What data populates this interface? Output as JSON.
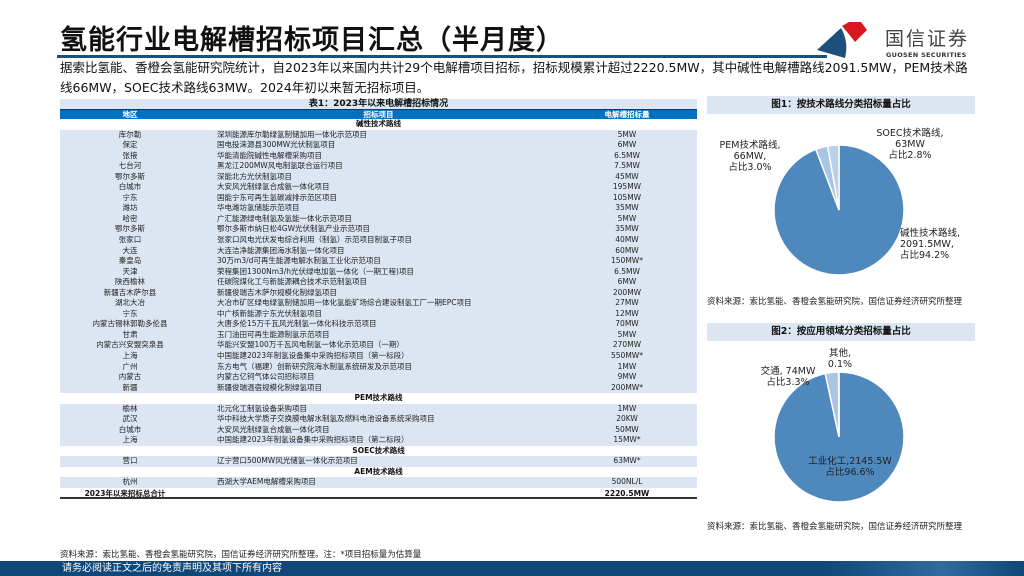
{
  "title": "氢能行业电解槽招标项目汇总（半月度）",
  "logo": {
    "cn": "国信证券",
    "en": "GUOSEN SECURITIES"
  },
  "intro": "据索比氢能、香橙会氢能研究院统计，自2023年以来国内共计29个电解槽项目招标，招标规模累计超过2220.5MW，其中碱性电解槽路线2091.5MW，PEM技术路线66MW，SOEC技术路线63MW。2024年初以来暂无招标项目。",
  "table": {
    "caption": "表1：2023年以来电解槽招标情况",
    "headers": [
      "地区",
      "招标项目",
      "电解槽招标量"
    ],
    "sections": [
      {
        "name": "碱性技术路线",
        "rows": [
          [
            "库尔勒",
            "深圳能源库尔勒绿氢制储加用一体化示范项目",
            "5MW"
          ],
          [
            "保定",
            "国电投涞源县300MW光伏制氢项目",
            "6MW"
          ],
          [
            "张掖",
            "华能清能院碱性电解槽采购项目",
            "6.5MW"
          ],
          [
            "七台河",
            "黑龙江200MW风电制氢联合运行项目",
            "7.5MW"
          ],
          [
            "鄂尔多斯",
            "深能北方光伏制氢项目",
            "45MW"
          ],
          [
            "白城市",
            "大安风光制绿氢合成氨一体化项目",
            "195MW"
          ],
          [
            "宁东",
            "国能宁东可再生氢碳减排示范区项目",
            "105MW"
          ],
          [
            "潍坊",
            "华电潍坊氢储能示范项目",
            "35MW"
          ],
          [
            "哈密",
            "广汇能源绿电制氢及氢能一体化示范项目",
            "5MW"
          ],
          [
            "鄂尔多斯",
            "鄂尔多斯市纳日松4GW光伏制氢产业示范项目",
            "35MW"
          ],
          [
            "张家口",
            "张家口风电光伏发电综合利用（制氢）示范项目制氢子项目",
            "40MW"
          ],
          [
            "大连",
            "大连洁净能源集团海水制氢一体化项目",
            "60MW"
          ],
          [
            "秦皇岛",
            "30万m3/d可再生能源电解水制氢工业化示范项目",
            "150MW*"
          ],
          [
            "天津",
            "荣程集团1300Nm3/h光伏绿电加氢一体化（一期工程)项目",
            "6.5MW"
          ],
          [
            "陕西榆林",
            "任碳院煤化工与新能源耦合技术示范制氢项目",
            "6MW"
          ],
          [
            "新疆吉木萨尔县",
            "新疆俊瑞吉木萨尔规模化制绿氢项目",
            "200MW"
          ],
          [
            "湖北大冶",
            "大冶市矿区绿电绿氢制储加用一体化氢能矿场综合建设制氢工厂一期EPC项目",
            "27MW"
          ],
          [
            "宁东",
            "中广核新能源宁东光伏制氢项目",
            "12MW"
          ],
          [
            "内蒙古锡林郭勒多伦县",
            "大唐多伦15万千瓦风光制氢一体化科技示范项目",
            "70MW"
          ],
          [
            "甘肃",
            "玉门油田可再生能源制氢示范项目",
            "5MW"
          ],
          [
            "内蒙古兴安盟突泉县",
            "华能兴安盟100万千瓦风电制氢一体化示范项目（一期）",
            "270MW"
          ],
          [
            "上海",
            "中国能建2023年制氢设备集中采购招标项目（第一标段）",
            "550MW*"
          ],
          [
            "广州",
            "东方电气（福建）创新研究院海水制氢系统研发及示范项目",
            "1MW"
          ],
          [
            "内蒙古",
            "内蒙古亿钶气体公司招标项目",
            "9MW"
          ],
          [
            "新疆",
            "新疆俊瑞温宿规模化制绿氢项目",
            "200MW*"
          ]
        ]
      },
      {
        "name": "PEM技术路线",
        "rows": [
          [
            "榆林",
            "北元化工制氢设备采购项目",
            "1MW"
          ],
          [
            "武汉",
            "华中科技大学质子交换膜电解水制氢及燃料电池设备系统采购项目",
            "20KW"
          ],
          [
            "白城市",
            "大安风光制绿氢合成氨一体化项目",
            "50MW"
          ],
          [
            "上海",
            "中国能建2023年制氢设备集中采购招标项目（第二标段）",
            "15MW*"
          ]
        ]
      },
      {
        "name": "SOEC技术路线",
        "rows": [
          [
            "营口",
            "辽宁营口500MW风光储氢一体化示范项目",
            "63MW*"
          ]
        ]
      },
      {
        "name": "AEM技术路线",
        "rows": [
          [
            "杭州",
            "西湖大学AEM电解槽采购项目",
            "500NL/L"
          ]
        ]
      }
    ],
    "total_label": "2023年以来招标总合计",
    "total_value": "2220.5MW",
    "source": "资料来源：索比氢能、香橙会氢能研究院，国信证券经济研究所整理。注：*项目招标量为估算量"
  },
  "chart_data": [
    {
      "type": "pie",
      "title": "图1：按技术路线分类招标量占比",
      "slices": [
        {
          "name": "碱性技术路线",
          "value_mw": 2091.5,
          "percent": 94.2,
          "label": [
            "碱性技术路线,",
            "2091.5MW,",
            "占比94.2%"
          ],
          "color": "#4f88bd"
        },
        {
          "name": "PEM技术路线",
          "value_mw": 66,
          "percent": 3.0,
          "label": [
            "PEM技术路线,",
            "66MW,",
            "占比3.0%"
          ],
          "color": "#a9c4e4"
        },
        {
          "name": "SOEC技术路线",
          "value_mw": 63,
          "percent": 2.8,
          "label": [
            "SOEC技术路线,",
            "63MW",
            "占比2.8%"
          ],
          "color": "#b9cfea"
        }
      ],
      "source": "资料来源：索比氢能、香橙会氢能研究院，国信证券经济研究所整理"
    },
    {
      "type": "pie",
      "title": "图2：按应用领域分类招标量占比",
      "slices": [
        {
          "name": "工业化工",
          "value_mw": 2145.5,
          "percent": 96.6,
          "label": [
            "工业化工,2145.5W",
            "占比96.6%"
          ],
          "color": "#4f88bd"
        },
        {
          "name": "交通",
          "value_mw": 74,
          "percent": 3.3,
          "label": [
            "交通, 74MW",
            "占比3.3%"
          ],
          "color": "#a9c4e4"
        },
        {
          "name": "其他",
          "percent": 0.1,
          "label": [
            "其他,",
            "0.1%"
          ],
          "color": "#b9cfea"
        }
      ],
      "source": "资料来源：索比氢能、香橙会氢能研究院，国信证券经济研究所整理"
    }
  ],
  "footer": "请务必阅读正文之后的免责声明及其项下所有内容"
}
